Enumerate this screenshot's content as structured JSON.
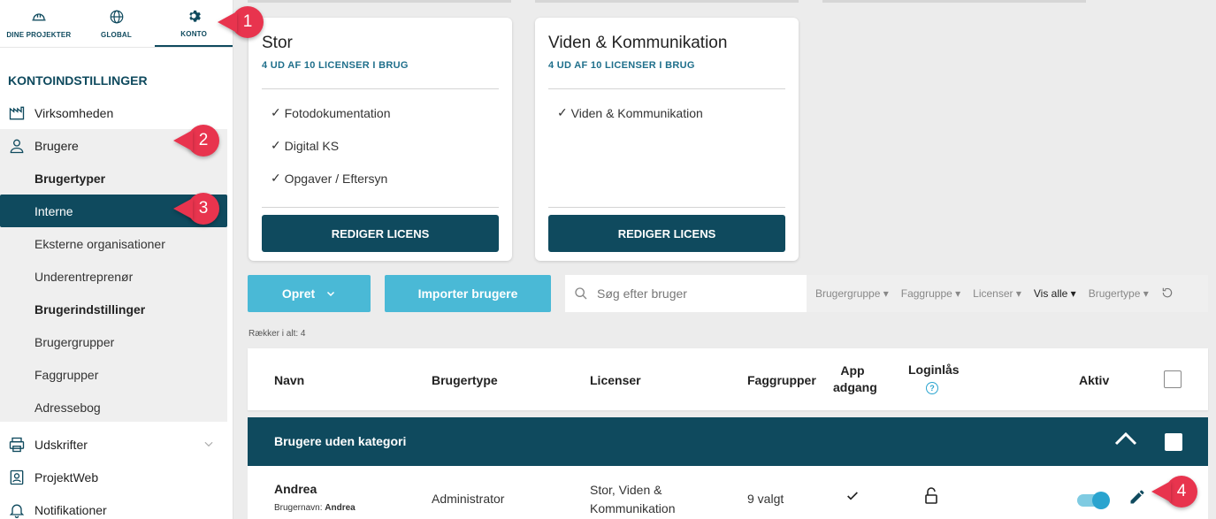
{
  "topnav": {
    "projects": "DINE PROJEKTER",
    "global": "GLOBAL",
    "account": "KONTO"
  },
  "sidebar": {
    "section_title": "KONTOINDSTILLINGER",
    "company": "Virksomheden",
    "users": "Brugere",
    "sub": {
      "user_types": "Brugertyper",
      "internal": "Interne",
      "external": "Eksterne organisationer",
      "subcontractor": "Underentreprenør",
      "user_settings": "Brugerindstillinger",
      "user_groups": "Brugergrupper",
      "trade_groups": "Faggrupper",
      "address_book": "Adressebog"
    },
    "printouts": "Udskrifter",
    "projectweb": "ProjektWeb",
    "notifications": "Notifikationer"
  },
  "callouts": [
    "1",
    "2",
    "3",
    "4"
  ],
  "cards": [
    {
      "title": "Stor",
      "usage": "4 UD AF 10 LICENSER I BRUG",
      "features": [
        "Fotodokumentation",
        "Digital KS",
        "Opgaver / Eftersyn"
      ],
      "button": "REDIGER LICENS"
    },
    {
      "title": "Viden & Kommunikation",
      "usage": "4 UD AF 10 LICENSER I BRUG",
      "features": [
        "Viden & Kommunikation"
      ],
      "button": "REDIGER LICENS"
    }
  ],
  "toolbar": {
    "create": "Opret",
    "import": "Importer brugere",
    "search_placeholder": "Søg efter bruger",
    "filters": [
      "Brugergruppe",
      "Faggruppe",
      "Licenser",
      "Vis alle",
      "Brugertype"
    ]
  },
  "rows_count": "Rækker i alt: 4",
  "table": {
    "headers": {
      "name": "Navn",
      "user_type": "Brugertype",
      "licenses": "Licenser",
      "trade_groups": "Faggrupper",
      "app_access_1": "App",
      "app_access_2": "adgang",
      "login_lock": "Loginlås",
      "active": "Aktiv"
    },
    "group_title": "Brugere uden kategori",
    "rows": [
      {
        "name": "Andrea",
        "username_label": "Brugernavn:",
        "username": "Andrea",
        "user_type": "Administrator",
        "licenses_1": "Stor, Viden &",
        "licenses_2": "Kommunikation",
        "trade_groups": "9 valgt",
        "active": true
      }
    ]
  },
  "colors": {
    "primary": "#0f4a5e",
    "accent": "#4ab9d6",
    "callout": "#e8344e"
  }
}
